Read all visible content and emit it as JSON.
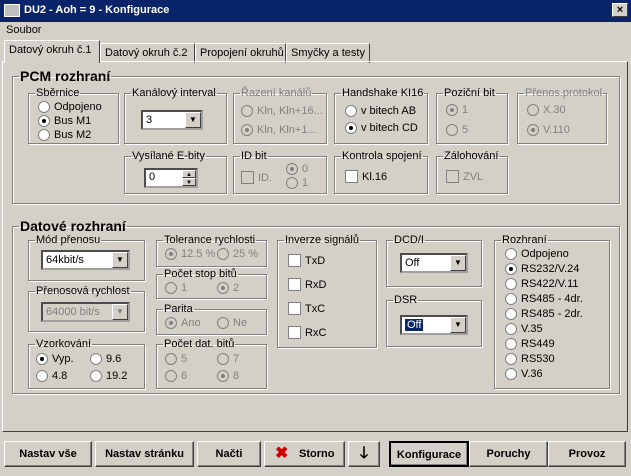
{
  "window": {
    "title": "DU2 - Aoh = 9 - Konfigurace",
    "close": "×"
  },
  "menu": {
    "file": "Soubor"
  },
  "tabs": [
    "Datový okruh č.1",
    "Datový okruh č.2",
    "Propojení okruhů",
    "Smyčky a testy"
  ],
  "pcm": {
    "title": "PCM rozhraní",
    "sbernice": {
      "title": "Sběrnice",
      "options": [
        "Odpojeno",
        "Bus M1",
        "Bus M2"
      ],
      "selected": 1
    },
    "kanalovy": {
      "title": "Kanálový interval",
      "value": "3"
    },
    "razeni": {
      "title": "Řazení kanálů",
      "options": [
        "Kln, Kln+16...",
        "Kln, Kln+1..."
      ]
    },
    "handshake": {
      "title": "Handshake KI16",
      "options": [
        "v bitech AB",
        "v bitech CD"
      ],
      "selected": 1
    },
    "pozicni": {
      "title": "Poziční bit",
      "options": [
        "1",
        "5"
      ]
    },
    "prenos": {
      "title": "Přenos.protokol",
      "options": [
        "X.30",
        "V.110"
      ]
    },
    "vysilane": {
      "title": "Vysílané E-bity",
      "value": "0"
    },
    "idbit": {
      "title": "ID bit",
      "check": "ID.",
      "options": [
        "0",
        "1"
      ]
    },
    "kontrola": {
      "title": "Kontrola spojení",
      "check": "Kl.16"
    },
    "zalohovani": {
      "title": "Zálohování",
      "check": "ZVL"
    }
  },
  "data": {
    "title": "Datové rozhraní",
    "mod": {
      "title": "Mód přenosu",
      "value": "64kbit/s"
    },
    "rychlost": {
      "title": "Přenosová rychlost",
      "value": "64000 bit/s"
    },
    "vzorkovani": {
      "title": "Vzorkování",
      "options": [
        "Vyp.",
        "9.6",
        "4.8",
        "19.2"
      ],
      "selected": 0
    },
    "tolerance": {
      "title": "Tolerance rychlosti",
      "options": [
        "12.5 %",
        "25 %"
      ]
    },
    "stop": {
      "title": "Počet stop bitů",
      "options": [
        "1",
        "2"
      ]
    },
    "parita": {
      "title": "Parita",
      "options": [
        "Ano",
        "Ne"
      ]
    },
    "datbit": {
      "title": "Počet dat. bitů",
      "options": [
        "5",
        "7",
        "6",
        "8"
      ]
    },
    "inverze": {
      "title": "Inverze signálů",
      "items": [
        "TxD",
        "RxD",
        "TxC",
        "RxC"
      ]
    },
    "dcd": {
      "title": "DCD/I",
      "value": "Off"
    },
    "dsr": {
      "title": "DSR",
      "value": "Off"
    },
    "rozhrani": {
      "title": "Rozhraní",
      "options": [
        "Odpojeno",
        "RS232/V.24",
        "RS422/V.11",
        "RS485 - 4dr.",
        "RS485 - 2dr.",
        "V.35",
        "RS449",
        "RS530",
        "V.36"
      ],
      "selected": 1
    }
  },
  "buttons": {
    "nastav_vse": "Nastav vše",
    "nastav_stranku": "Nastav stránku",
    "nacti": "Načti",
    "storno": "Storno",
    "konfigurace": "Konfigurace",
    "poruchy": "Poruchy",
    "provoz": "Provoz"
  },
  "colors": {
    "titlebar": "#0a246a",
    "storno_icon": "#d40000"
  }
}
